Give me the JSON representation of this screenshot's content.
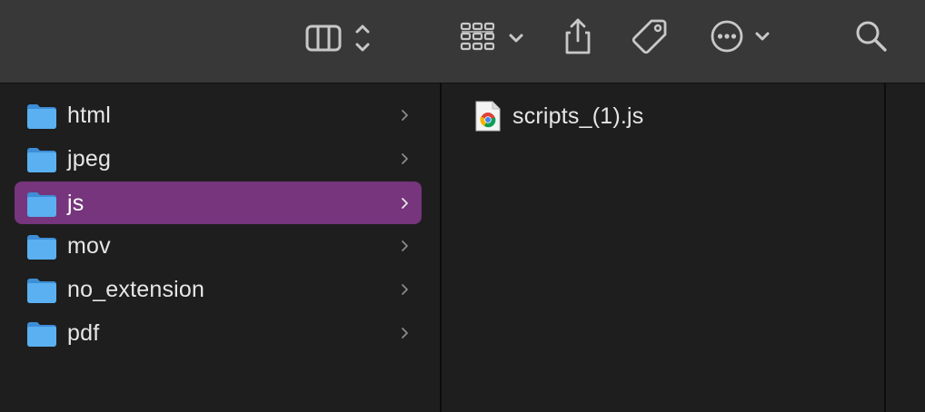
{
  "toolbar": {
    "buttons": [
      {
        "name": "view-columns",
        "icon": "columns-view-icon"
      },
      {
        "name": "group-by",
        "icon": "grid-group-icon"
      },
      {
        "name": "share",
        "icon": "share-icon"
      },
      {
        "name": "tags",
        "icon": "tag-icon"
      },
      {
        "name": "more-actions",
        "icon": "ellipsis-circle-icon"
      },
      {
        "name": "search",
        "icon": "search-icon"
      }
    ]
  },
  "sidebar_column": {
    "items": [
      {
        "label": "html",
        "icon": "folder-icon",
        "selected": false
      },
      {
        "label": "jpeg",
        "icon": "folder-icon",
        "selected": false
      },
      {
        "label": "js",
        "icon": "folder-icon",
        "selected": true
      },
      {
        "label": "mov",
        "icon": "folder-icon",
        "selected": false
      },
      {
        "label": "no_extension",
        "icon": "folder-icon",
        "selected": false
      },
      {
        "label": "pdf",
        "icon": "folder-icon",
        "selected": false
      }
    ]
  },
  "content_column": {
    "files": [
      {
        "label": "scripts_(1).js",
        "icon": "chrome-document-icon"
      }
    ]
  },
  "colors": {
    "selection": "#76357c",
    "folder": "#5ab0f0",
    "toolbar_bg": "#383838",
    "column_bg": "#1e1e1e",
    "text": "#e6e6e6"
  }
}
